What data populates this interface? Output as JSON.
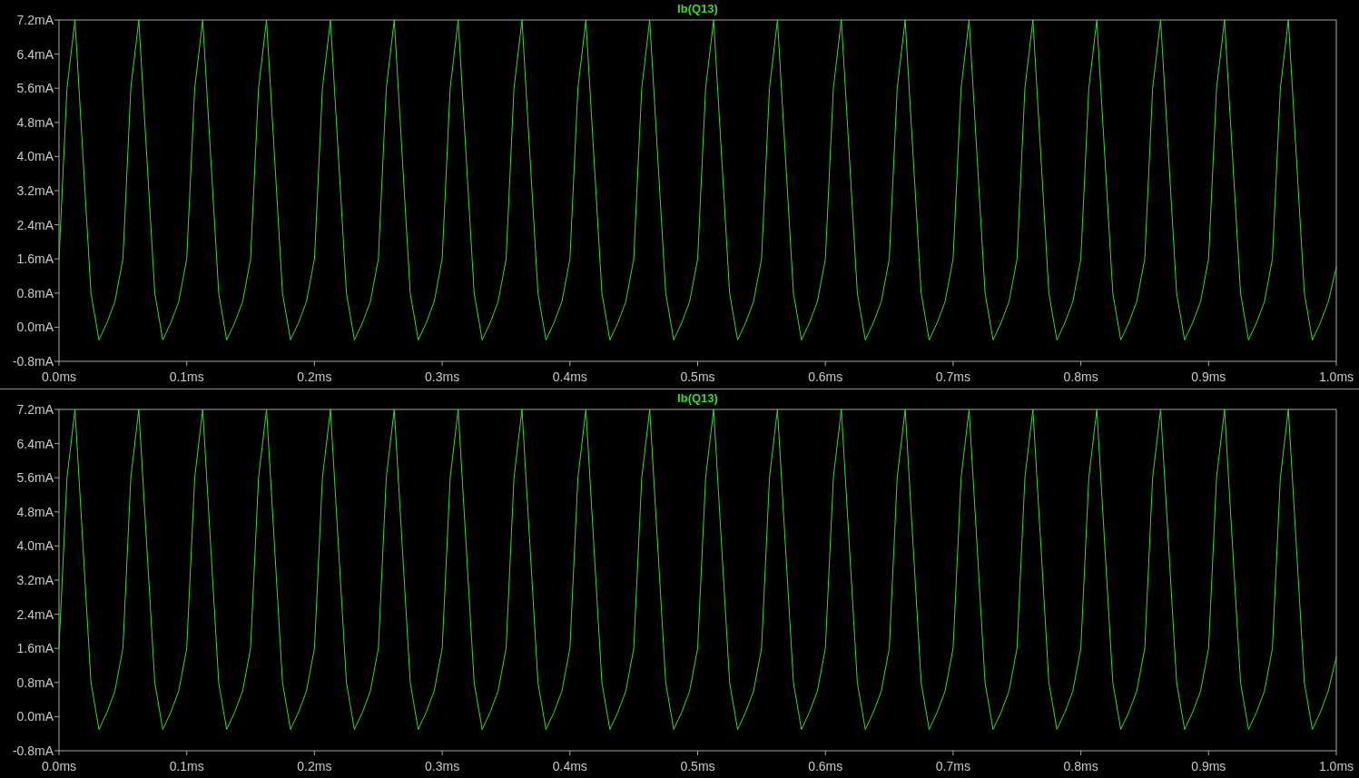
{
  "panes": [
    {
      "chart_data": {
        "type": "line",
        "xlim": [
          0,
          1
        ],
        "ylim": [
          -0.8,
          7.2
        ],
        "x": [
          0,
          0.00625,
          0.0125,
          0.01875,
          0.025,
          0.03125,
          0.0375,
          0.04375,
          0.05,
          0.05625,
          0.0625,
          0.06875,
          0.075,
          0.08125,
          0.0875,
          0.09375,
          0.1,
          0.10625,
          0.1125,
          0.11875,
          0.125,
          0.13125,
          0.1375,
          0.14375,
          0.15,
          0.15625,
          0.1625,
          0.16875,
          0.175,
          0.18125,
          0.1875,
          0.19375,
          0.2,
          0.20625,
          0.2125,
          0.21875,
          0.225,
          0.23125,
          0.2375,
          0.24375,
          0.25,
          0.25625,
          0.2625,
          0.26875,
          0.275,
          0.28125,
          0.2875,
          0.29375,
          0.3,
          0.30625,
          0.3125,
          0.31875,
          0.325,
          0.33125,
          0.3375,
          0.34375,
          0.35,
          0.35625,
          0.3625,
          0.36875,
          0.375,
          0.38125,
          0.3875,
          0.39375,
          0.4,
          0.40625,
          0.4125,
          0.41875,
          0.425,
          0.43125,
          0.4375,
          0.44375,
          0.45,
          0.45625,
          0.4625,
          0.46875,
          0.475,
          0.48125,
          0.4875,
          0.49375,
          0.5,
          0.50625,
          0.5125,
          0.51875,
          0.525,
          0.53125,
          0.5375,
          0.54375,
          0.55,
          0.55625,
          0.5625,
          0.56875,
          0.575,
          0.58125,
          0.5875,
          0.59375,
          0.6,
          0.60625,
          0.6125,
          0.61875,
          0.625,
          0.63125,
          0.6375,
          0.64375,
          0.65,
          0.65625,
          0.6625,
          0.66875,
          0.675,
          0.68125,
          0.6875,
          0.69375,
          0.7,
          0.70625,
          0.7125,
          0.71875,
          0.725,
          0.73125,
          0.7375,
          0.74375,
          0.75,
          0.75625,
          0.7625,
          0.76875,
          0.775,
          0.78125,
          0.7875,
          0.79375,
          0.8,
          0.80625,
          0.8125,
          0.81875,
          0.825,
          0.83125,
          0.8375,
          0.84375,
          0.85,
          0.85625,
          0.8625,
          0.86875,
          0.875,
          0.88125,
          0.8875,
          0.89375,
          0.9,
          0.90625,
          0.9125,
          0.91875,
          0.925,
          0.93125,
          0.9375,
          0.94375,
          0.95,
          0.95625,
          0.9625,
          0.96875,
          0.975,
          0.98125,
          0.9875,
          0.99375,
          1
        ],
        "xticks": [
          {
            "value": 0,
            "label": "0.0ms"
          },
          {
            "value": 0.1,
            "label": "0.1ms"
          },
          {
            "value": 0.2,
            "label": "0.2ms"
          },
          {
            "value": 0.3,
            "label": "0.3ms"
          },
          {
            "value": 0.4,
            "label": "0.4ms"
          },
          {
            "value": 0.5,
            "label": "0.5ms"
          },
          {
            "value": 0.6,
            "label": "0.6ms"
          },
          {
            "value": 0.7,
            "label": "0.7ms"
          },
          {
            "value": 0.8,
            "label": "0.8ms"
          },
          {
            "value": 0.9,
            "label": "0.9ms"
          },
          {
            "value": 1,
            "label": "1.0ms"
          }
        ],
        "yticks": [
          {
            "value": 7.2,
            "label": "7.2mA"
          },
          {
            "value": 6.4,
            "label": "6.4mA"
          },
          {
            "value": 5.6,
            "label": "5.6mA"
          },
          {
            "value": 4.8,
            "label": "4.8mA"
          },
          {
            "value": 4.0,
            "label": "4.0mA"
          },
          {
            "value": 3.2,
            "label": "3.2mA"
          },
          {
            "value": 2.4,
            "label": "2.4mA"
          },
          {
            "value": 1.6,
            "label": "1.6mA"
          },
          {
            "value": 0.8,
            "label": "0.8mA"
          },
          {
            "value": 0,
            "label": "0.0mA"
          },
          {
            "value": -0.8,
            "label": "-0.8mA"
          }
        ],
        "series": [
          {
            "name": "Ib(Q13)",
            "color": "#33dd33",
            "values": [
              1.6,
              5.6,
              7.2,
              4.0,
              0.8,
              -0.3,
              0.1,
              0.6,
              1.6,
              5.6,
              7.2,
              4.0,
              0.8,
              -0.3,
              0.1,
              0.6,
              1.6,
              5.6,
              7.2,
              4.0,
              0.8,
              -0.3,
              0.1,
              0.6,
              1.6,
              5.6,
              7.2,
              4.0,
              0.8,
              -0.3,
              0.1,
              0.6,
              1.6,
              5.6,
              7.2,
              4.0,
              0.8,
              -0.3,
              0.1,
              0.6,
              1.6,
              5.6,
              7.2,
              4.0,
              0.8,
              -0.3,
              0.1,
              0.6,
              1.6,
              5.6,
              7.2,
              4.0,
              0.8,
              -0.3,
              0.1,
              0.6,
              1.6,
              5.6,
              7.2,
              4.0,
              0.8,
              -0.3,
              0.1,
              0.6,
              1.6,
              5.6,
              7.2,
              4.0,
              0.8,
              -0.3,
              0.1,
              0.6,
              1.6,
              5.6,
              7.2,
              4.0,
              0.8,
              -0.3,
              0.1,
              0.6,
              1.6,
              5.6,
              7.2,
              4.0,
              0.8,
              -0.3,
              0.1,
              0.6,
              1.6,
              5.6,
              7.2,
              4.0,
              0.8,
              -0.3,
              0.1,
              0.6,
              1.6,
              5.6,
              7.2,
              4.0,
              0.8,
              -0.3,
              0.1,
              0.6,
              1.6,
              5.6,
              7.2,
              4.0,
              0.8,
              -0.3,
              0.1,
              0.6,
              1.6,
              5.6,
              7.2,
              4.0,
              0.8,
              -0.3,
              0.1,
              0.6,
              1.6,
              5.6,
              7.2,
              4.0,
              0.8,
              -0.3,
              0.1,
              0.6,
              1.6,
              5.6,
              7.2,
              4.0,
              0.8,
              -0.3,
              0.1,
              0.6,
              1.6,
              5.6,
              7.2,
              4.0,
              0.8,
              -0.3,
              0.1,
              0.6,
              1.6,
              5.6,
              7.2,
              4.0,
              0.8,
              -0.3,
              0.1,
              0.6,
              1.6,
              5.6,
              7.2,
              4.0,
              0.8,
              -0.3,
              0.1,
              0.6,
              1.4
            ]
          }
        ]
      }
    },
    {
      "chart_data": {
        "type": "line",
        "xlim": [
          0,
          1
        ],
        "ylim": [
          -0.8,
          7.2
        ],
        "x": [
          0,
          0.00625,
          0.0125,
          0.01875,
          0.025,
          0.03125,
          0.0375,
          0.04375,
          0.05,
          0.05625,
          0.0625,
          0.06875,
          0.075,
          0.08125,
          0.0875,
          0.09375,
          0.1,
          0.10625,
          0.1125,
          0.11875,
          0.125,
          0.13125,
          0.1375,
          0.14375,
          0.15,
          0.15625,
          0.1625,
          0.16875,
          0.175,
          0.18125,
          0.1875,
          0.19375,
          0.2,
          0.20625,
          0.2125,
          0.21875,
          0.225,
          0.23125,
          0.2375,
          0.24375,
          0.25,
          0.25625,
          0.2625,
          0.26875,
          0.275,
          0.28125,
          0.2875,
          0.29375,
          0.3,
          0.30625,
          0.3125,
          0.31875,
          0.325,
          0.33125,
          0.3375,
          0.34375,
          0.35,
          0.35625,
          0.3625,
          0.36875,
          0.375,
          0.38125,
          0.3875,
          0.39375,
          0.4,
          0.40625,
          0.4125,
          0.41875,
          0.425,
          0.43125,
          0.4375,
          0.44375,
          0.45,
          0.45625,
          0.4625,
          0.46875,
          0.475,
          0.48125,
          0.4875,
          0.49375,
          0.5,
          0.50625,
          0.5125,
          0.51875,
          0.525,
          0.53125,
          0.5375,
          0.54375,
          0.55,
          0.55625,
          0.5625,
          0.56875,
          0.575,
          0.58125,
          0.5875,
          0.59375,
          0.6,
          0.60625,
          0.6125,
          0.61875,
          0.625,
          0.63125,
          0.6375,
          0.64375,
          0.65,
          0.65625,
          0.6625,
          0.66875,
          0.675,
          0.68125,
          0.6875,
          0.69375,
          0.7,
          0.70625,
          0.7125,
          0.71875,
          0.725,
          0.73125,
          0.7375,
          0.74375,
          0.75,
          0.75625,
          0.7625,
          0.76875,
          0.775,
          0.78125,
          0.7875,
          0.79375,
          0.8,
          0.80625,
          0.8125,
          0.81875,
          0.825,
          0.83125,
          0.8375,
          0.84375,
          0.85,
          0.85625,
          0.8625,
          0.86875,
          0.875,
          0.88125,
          0.8875,
          0.89375,
          0.9,
          0.90625,
          0.9125,
          0.91875,
          0.925,
          0.93125,
          0.9375,
          0.94375,
          0.95,
          0.95625,
          0.9625,
          0.96875,
          0.975,
          0.98125,
          0.9875,
          0.99375,
          1
        ],
        "xticks": [
          {
            "value": 0,
            "label": "0.0ms"
          },
          {
            "value": 0.1,
            "label": "0.1ms"
          },
          {
            "value": 0.2,
            "label": "0.2ms"
          },
          {
            "value": 0.3,
            "label": "0.3ms"
          },
          {
            "value": 0.4,
            "label": "0.4ms"
          },
          {
            "value": 0.5,
            "label": "0.5ms"
          },
          {
            "value": 0.6,
            "label": "0.6ms"
          },
          {
            "value": 0.7,
            "label": "0.7ms"
          },
          {
            "value": 0.8,
            "label": "0.8ms"
          },
          {
            "value": 0.9,
            "label": "0.9ms"
          },
          {
            "value": 1,
            "label": "1.0ms"
          }
        ],
        "yticks": [
          {
            "value": 7.2,
            "label": "7.2mA"
          },
          {
            "value": 6.4,
            "label": "6.4mA"
          },
          {
            "value": 5.6,
            "label": "5.6mA"
          },
          {
            "value": 4.8,
            "label": "4.8mA"
          },
          {
            "value": 4.0,
            "label": "4.0mA"
          },
          {
            "value": 3.2,
            "label": "3.2mA"
          },
          {
            "value": 2.4,
            "label": "2.4mA"
          },
          {
            "value": 1.6,
            "label": "1.6mA"
          },
          {
            "value": 0.8,
            "label": "0.8mA"
          },
          {
            "value": 0,
            "label": "0.0mA"
          },
          {
            "value": -0.8,
            "label": "-0.8mA"
          }
        ],
        "series": [
          {
            "name": "Ib(Q13)",
            "color": "#33dd33",
            "values": [
              1.6,
              5.6,
              7.2,
              4.0,
              0.8,
              -0.3,
              0.1,
              0.6,
              1.6,
              5.6,
              7.2,
              4.0,
              0.8,
              -0.3,
              0.1,
              0.6,
              1.6,
              5.6,
              7.2,
              4.0,
              0.8,
              -0.3,
              0.1,
              0.6,
              1.6,
              5.6,
              7.2,
              4.0,
              0.8,
              -0.3,
              0.1,
              0.6,
              1.6,
              5.6,
              7.2,
              4.0,
              0.8,
              -0.3,
              0.1,
              0.6,
              1.6,
              5.6,
              7.2,
              4.0,
              0.8,
              -0.3,
              0.1,
              0.6,
              1.6,
              5.6,
              7.2,
              4.0,
              0.8,
              -0.3,
              0.1,
              0.6,
              1.6,
              5.6,
              7.2,
              4.0,
              0.8,
              -0.3,
              0.1,
              0.6,
              1.6,
              5.6,
              7.2,
              4.0,
              0.8,
              -0.3,
              0.1,
              0.6,
              1.6,
              5.6,
              7.2,
              4.0,
              0.8,
              -0.3,
              0.1,
              0.6,
              1.6,
              5.6,
              7.2,
              4.0,
              0.8,
              -0.3,
              0.1,
              0.6,
              1.6,
              5.6,
              7.2,
              4.0,
              0.8,
              -0.3,
              0.1,
              0.6,
              1.6,
              5.6,
              7.2,
              4.0,
              0.8,
              -0.3,
              0.1,
              0.6,
              1.6,
              5.6,
              7.2,
              4.0,
              0.8,
              -0.3,
              0.1,
              0.6,
              1.6,
              5.6,
              7.2,
              4.0,
              0.8,
              -0.3,
              0.1,
              0.6,
              1.6,
              5.6,
              7.2,
              4.0,
              0.8,
              -0.3,
              0.1,
              0.6,
              1.6,
              5.6,
              7.2,
              4.0,
              0.8,
              -0.3,
              0.1,
              0.6,
              1.6,
              5.6,
              7.2,
              4.0,
              0.8,
              -0.3,
              0.1,
              0.6,
              1.6,
              5.6,
              7.2,
              4.0,
              0.8,
              -0.3,
              0.1,
              0.6,
              1.6,
              5.6,
              7.2,
              4.0,
              0.8,
              -0.3,
              0.1,
              0.6,
              1.4
            ]
          }
        ]
      }
    }
  ]
}
